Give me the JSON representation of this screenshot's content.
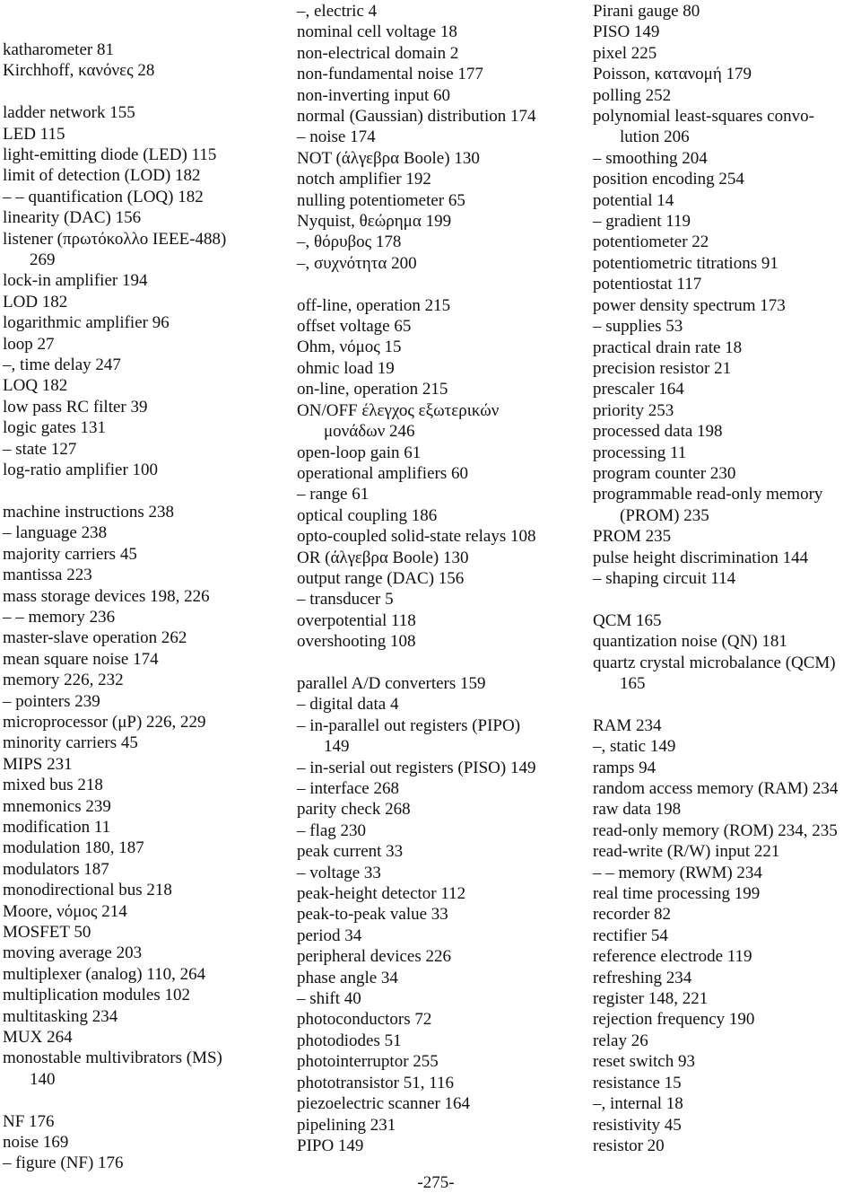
{
  "document": {
    "type": "book index page",
    "page_number": "-275-"
  },
  "columns": [
    {
      "name": "left",
      "entries": [
        {
          "text": "katharometer 81"
        },
        {
          "text": "Kirchhoff, κανόνες 28"
        },
        {
          "gap": true
        },
        {
          "text": "ladder network 155"
        },
        {
          "text": "LED 115"
        },
        {
          "text": "light-emitting diode (LED) 115"
        },
        {
          "text": "limit of detection (LOD) 182"
        },
        {
          "text": "– – quantification (LOQ) 182"
        },
        {
          "text": "linearity (DAC) 156"
        },
        {
          "text": "listener (πρωτόκολλο IEEE-488)",
          "cont": "269"
        },
        {
          "text": "lock-in amplifier 194"
        },
        {
          "text": "LOD 182"
        },
        {
          "text": "logarithmic amplifier 96"
        },
        {
          "text": "loop 27"
        },
        {
          "text": "–, time delay 247"
        },
        {
          "text": "LOQ 182"
        },
        {
          "text": "low pass RC filter 39"
        },
        {
          "text": "logic gates 131"
        },
        {
          "text": "– state 127"
        },
        {
          "text": "log-ratio amplifier 100"
        },
        {
          "gap": true
        },
        {
          "text": "machine instructions 238"
        },
        {
          "text": "– language 238"
        },
        {
          "text": "majority carriers 45"
        },
        {
          "text": "mantissa 223"
        },
        {
          "text": "mass storage devices 198, 226"
        },
        {
          "text": "– – memory 236"
        },
        {
          "text": "master-slave operation 262"
        },
        {
          "text": "mean square noise 174"
        },
        {
          "text": "memory 226, 232"
        },
        {
          "text": "– pointers 239"
        },
        {
          "text": "microprocessor (μP) 226, 229"
        },
        {
          "text": "minority carriers 45"
        },
        {
          "text": "MIPS 231"
        },
        {
          "text": "mixed bus 218"
        },
        {
          "text": "mnemonics 239"
        },
        {
          "text": "modification 11"
        },
        {
          "text": "modulation 180, 187"
        },
        {
          "text": "modulators 187"
        },
        {
          "text": "monodirectional bus 218"
        },
        {
          "text": "Moore, νόμος 214"
        },
        {
          "text": "MOSFET 50"
        },
        {
          "text": "moving average 203"
        },
        {
          "text": "multiplexer (analog) 110, 264"
        },
        {
          "text": "multiplication modules 102"
        },
        {
          "text": "multitasking 234"
        },
        {
          "text": "MUX 264"
        },
        {
          "text": "monostable multivibrators (MS)",
          "cont": "140"
        },
        {
          "gap": true
        },
        {
          "text": "NF 176"
        },
        {
          "text": "noise 169"
        },
        {
          "text": "– figure (NF) 176"
        }
      ]
    },
    {
      "name": "middle",
      "entries": [
        {
          "text": "–, electric 4"
        },
        {
          "text": "nominal cell voltage 18"
        },
        {
          "text": "non-electrical domain 2"
        },
        {
          "text": "non-fundamental noise 177"
        },
        {
          "text": "non-inverting input 60"
        },
        {
          "text": "normal (Gaussian) distribution 174"
        },
        {
          "text": "– noise 174"
        },
        {
          "text": "NOT (άλγεβρα Boole) 130"
        },
        {
          "text": "notch amplifier 192"
        },
        {
          "text": "nulling potentiometer 65"
        },
        {
          "text": "Nyquist, θεώρημα 199"
        },
        {
          "text": "–, θόρυβος 178"
        },
        {
          "text": "–, συχνότητα 200"
        },
        {
          "gap": true
        },
        {
          "text": "off-line, operation 215"
        },
        {
          "text": "offset voltage 65"
        },
        {
          "text": "Ohm, νόμος 15"
        },
        {
          "text": "ohmic load 19"
        },
        {
          "text": "on-line, operation 215"
        },
        {
          "text": "ON/OFF έλεγχος εξωτερικών",
          "cont": "μονάδων 246"
        },
        {
          "text": "open-loop gain 61"
        },
        {
          "text": "operational amplifiers 60"
        },
        {
          "text": "– range 61"
        },
        {
          "text": "optical coupling 186"
        },
        {
          "text": "opto-coupled solid-state relays 108"
        },
        {
          "text": "OR (άλγεβρα Boole) 130"
        },
        {
          "text": "output range (DAC) 156"
        },
        {
          "text": "– transducer 5"
        },
        {
          "text": "overpotential 118"
        },
        {
          "text": "overshooting 108"
        },
        {
          "gap": true
        },
        {
          "text": "parallel A/D converters 159"
        },
        {
          "text": "– digital data 4"
        },
        {
          "text": "– in-parallel out registers (PIPO)",
          "cont": "149"
        },
        {
          "text": "– in-serial out registers (PISO) 149"
        },
        {
          "text": "– interface 268"
        },
        {
          "text": "parity check 268"
        },
        {
          "text": "– flag 230"
        },
        {
          "text": "peak current 33"
        },
        {
          "text": "– voltage 33"
        },
        {
          "text": "peak-height detector 112"
        },
        {
          "text": "peak-to-peak value 33"
        },
        {
          "text": "period 34"
        },
        {
          "text": "peripheral devices 226"
        },
        {
          "text": "phase angle 34"
        },
        {
          "text": "– shift 40"
        },
        {
          "text": "photoconductors 72"
        },
        {
          "text": "photodiodes 51"
        },
        {
          "text": "photointerruptor 255"
        },
        {
          "text": "phototransistor 51, 116"
        },
        {
          "text": "piezoelectric scanner 164"
        },
        {
          "text": "pipelining 231"
        },
        {
          "text": "PIPO 149"
        }
      ]
    },
    {
      "name": "right",
      "entries": [
        {
          "text": "Pirani gauge 80"
        },
        {
          "text": "PISO 149"
        },
        {
          "text": "pixel 225"
        },
        {
          "text": "Poisson, κατανομή 179"
        },
        {
          "text": "polling 252"
        },
        {
          "text": "polynomial least-squares convo-",
          "cont": "lution 206"
        },
        {
          "text": "– smoothing 204"
        },
        {
          "text": "position encoding 254"
        },
        {
          "text": "potential 14"
        },
        {
          "text": "– gradient 119"
        },
        {
          "text": "potentiometer 22"
        },
        {
          "text": "potentiometric titrations 91"
        },
        {
          "text": "potentiostat 117"
        },
        {
          "text": "power density spectrum 173"
        },
        {
          "text": "– supplies 53"
        },
        {
          "text": "practical drain rate 18"
        },
        {
          "text": "precision resistor 21"
        },
        {
          "text": "prescaler 164"
        },
        {
          "text": "priority 253"
        },
        {
          "text": "processed data 198"
        },
        {
          "text": "processing 11"
        },
        {
          "text": "program counter 230"
        },
        {
          "text": "programmable read-only memory",
          "cont": "(PROM) 235"
        },
        {
          "text": "PROM 235"
        },
        {
          "text": "pulse height discrimination 144"
        },
        {
          "text": "– shaping circuit 114"
        },
        {
          "gap": true
        },
        {
          "text": "QCM 165"
        },
        {
          "text": "quantization noise (QN) 181"
        },
        {
          "text": "quartz crystal microbalance (QCM)",
          "cont": "165"
        },
        {
          "gap": true
        },
        {
          "text": "RAM 234"
        },
        {
          "text": "–, static 149"
        },
        {
          "text": "ramps 94"
        },
        {
          "text": "random access memory (RAM) 234"
        },
        {
          "text": "raw data 198"
        },
        {
          "text": "read-only memory (ROM) 234, 235"
        },
        {
          "text": "read-write (R/W) input 221"
        },
        {
          "text": "– – memory (RWM) 234"
        },
        {
          "text": "real time processing 199"
        },
        {
          "text": "recorder 82"
        },
        {
          "text": "rectifier 54"
        },
        {
          "text": "reference electrode 119"
        },
        {
          "text": "refreshing 234"
        },
        {
          "text": "register 148, 221"
        },
        {
          "text": "rejection frequency 190"
        },
        {
          "text": "relay 26"
        },
        {
          "text": "reset switch 93"
        },
        {
          "text": "resistance 15"
        },
        {
          "text": "–, internal 18"
        },
        {
          "text": "resistivity 45"
        },
        {
          "text": "resistor 20"
        }
      ]
    }
  ]
}
